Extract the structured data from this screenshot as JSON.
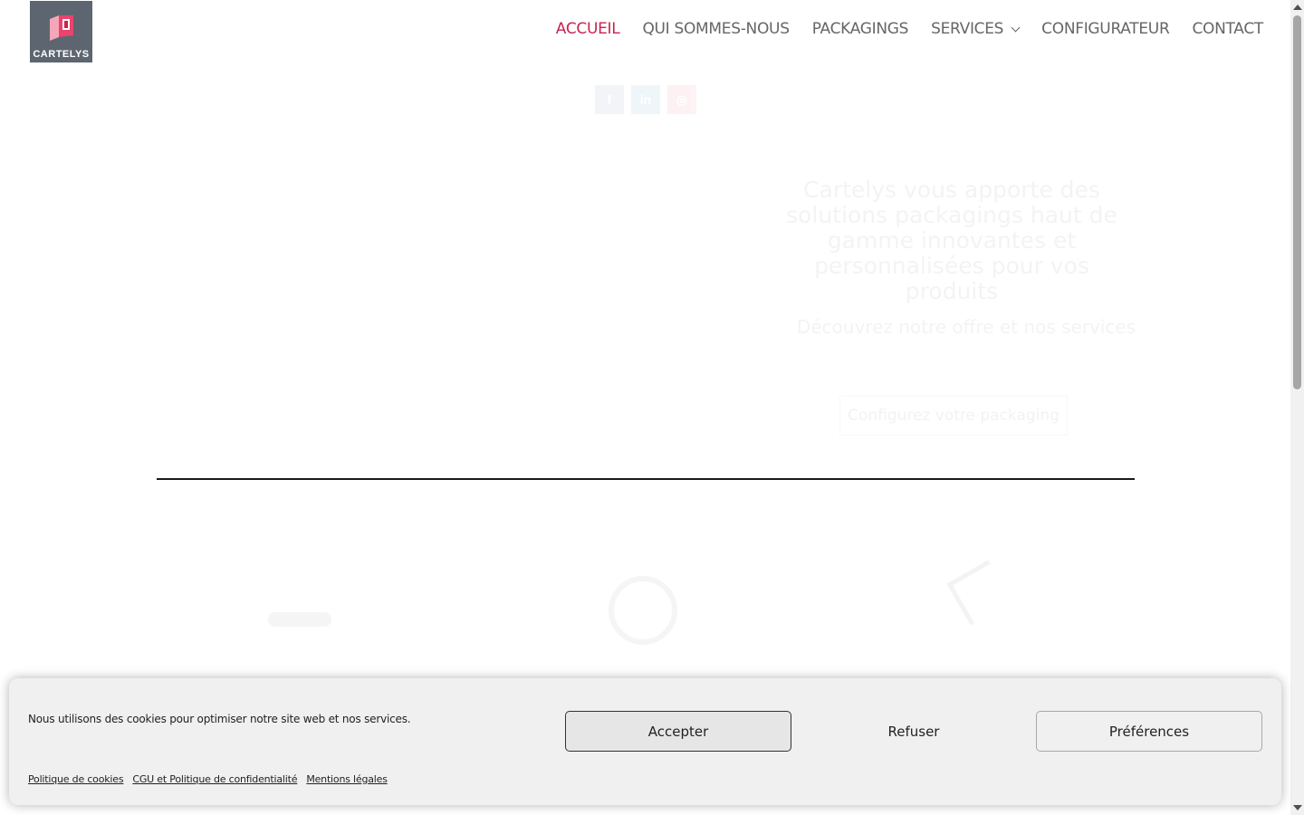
{
  "brand": {
    "logo_text": "CARTELYS"
  },
  "nav": {
    "items": [
      {
        "label": "ACCUEIL",
        "active": true
      },
      {
        "label": "QUI SOMMES-NOUS"
      },
      {
        "label": "PACKAGINGS"
      },
      {
        "label": "SERVICES",
        "has_dropdown": true
      },
      {
        "label": "CONFIGURATEUR"
      },
      {
        "label": "CONTACT"
      }
    ],
    "active_color": "#c8234f"
  },
  "social": {
    "icons": [
      "facebook-icon",
      "linkedin-icon",
      "instagram-icon"
    ]
  },
  "hero": {
    "title": "Cartelys vous apporte des solutions packagings haut de gamme innovantes et personnalisées pour vos produits",
    "subtitle": "Découvrez notre offre et nos services",
    "button_label": "Configurez votre packaging"
  },
  "cookie_banner": {
    "message": "Nous utilisons des cookies pour optimiser notre site web et nos services.",
    "accept_label": "Accepter",
    "refuse_label": "Refuser",
    "preferences_label": "Préférences",
    "links": [
      "Politique de cookies",
      "CGU et Politique de confidentialité",
      "Mentions légales"
    ]
  }
}
